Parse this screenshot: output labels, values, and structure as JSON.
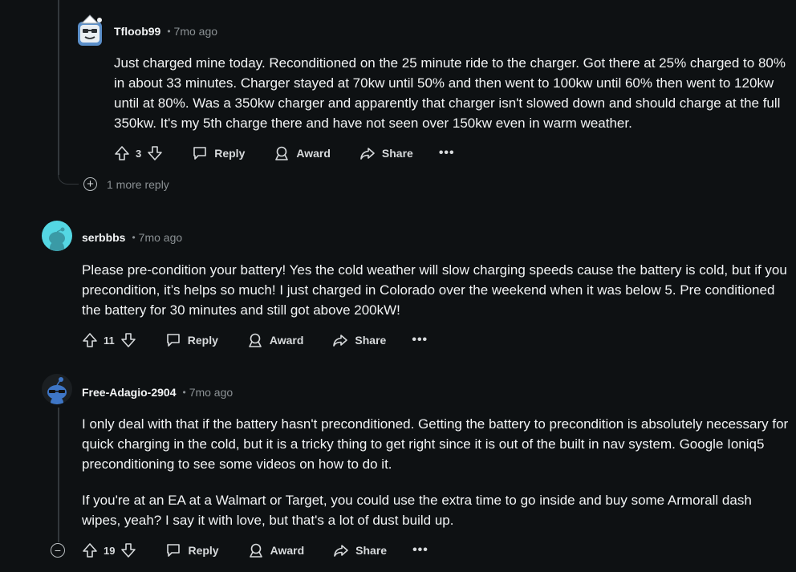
{
  "comments": [
    {
      "username": "Tfloob99",
      "time": "7mo ago",
      "paragraphs": [
        "Just charged mine today. Reconditioned on the 25 minute ride to the charger. Got there at 25% charged to 80% in about 33 minutes. Charger stayed at 70kw until 50% and then went to 100kw until 60% then went to 120kw until at 80%. Was a 350kw charger and apparently that charger isn't slowed down and should charge at the full 350kw. It's my 5th charge there and have not seen over 150kw even in warm weather."
      ],
      "votes": "3"
    },
    {
      "username": "serbbbs",
      "time": "7mo ago",
      "paragraphs": [
        "Please pre-condition your battery! Yes the cold weather will slow charging speeds cause the battery is cold, but if you precondition, it’s helps so much! I just charged in Colorado over the weekend when it was below 5. Pre conditioned the battery for 30 minutes and still got above 200kW!"
      ],
      "votes": "11"
    },
    {
      "username": "Free-Adagio-2904",
      "time": "7mo ago",
      "paragraphs": [
        "I only deal with that if the battery hasn't preconditioned. Getting the battery to precondition is absolutely necessary for quick charging in the cold, but it is a tricky thing to get right since it is out of the built in nav system. Google Ioniq5 preconditioning to see some videos on how to do it.",
        "If you're at an EA at a Walmart or Target, you could use the extra time to go inside and buy some Armorall dash wipes, yeah? I say it with love, but that's a lot of dust build up."
      ],
      "votes": "19"
    }
  ],
  "more_replies": "1 more reply",
  "actions": {
    "reply": "Reply",
    "award": "Award",
    "share": "Share",
    "more": "•••"
  },
  "separator": "•",
  "colors": {
    "background": "#0e1113",
    "thread_line": "#33383c",
    "text": "#f2f4f5",
    "meta": "#8b9194"
  }
}
